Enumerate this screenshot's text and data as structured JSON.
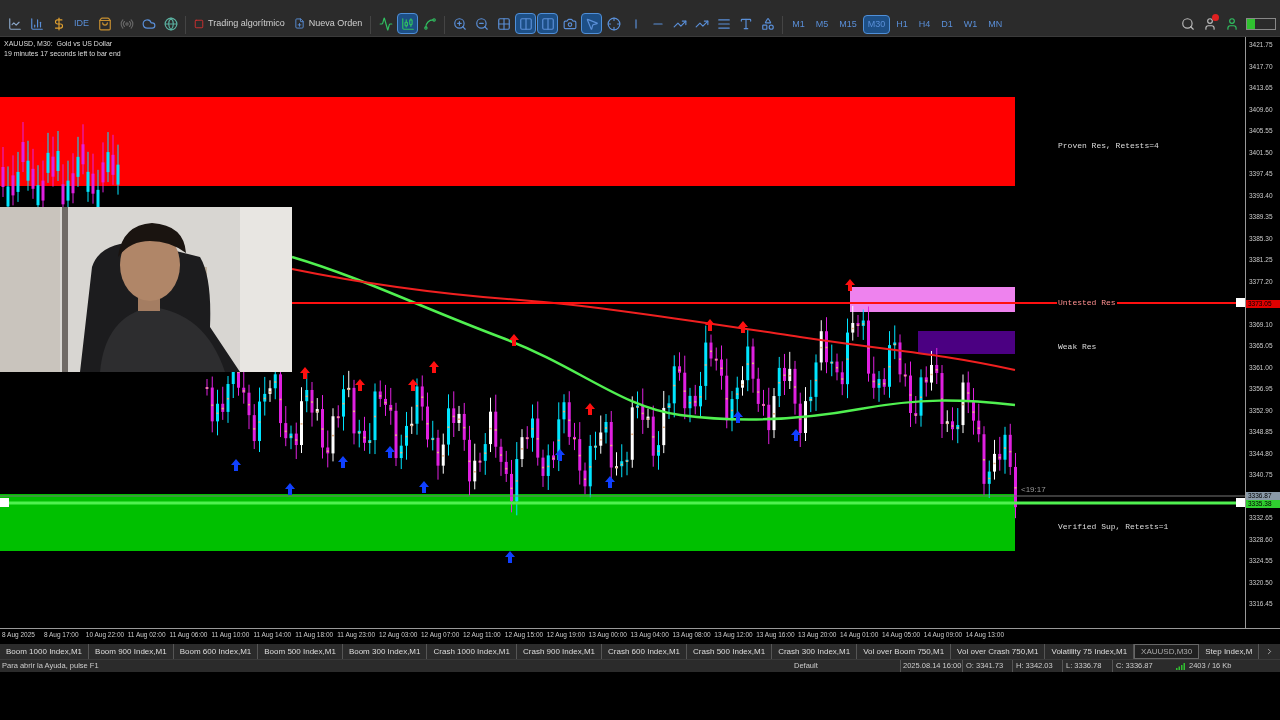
{
  "toolbar": {
    "ide_label": "IDE",
    "actions": [
      {
        "kind": "algo",
        "label": "Trading algorítmico"
      },
      {
        "kind": "order",
        "label": "Nueva Orden"
      }
    ],
    "timeframes": [
      {
        "label": "M1",
        "selected": false
      },
      {
        "label": "M5",
        "selected": false
      },
      {
        "label": "M15",
        "selected": false
      },
      {
        "label": "M30",
        "selected": true
      },
      {
        "label": "H1",
        "selected": false
      },
      {
        "label": "H4",
        "selected": false
      },
      {
        "label": "D1",
        "selected": false
      },
      {
        "label": "W1",
        "selected": false
      },
      {
        "label": "MN",
        "selected": false
      }
    ]
  },
  "chart": {
    "title": "XAUUSD, M30:  Gold vs US Dollar",
    "timer": "19 minutes 17 seconds left to bar end",
    "countdown": "<19:17",
    "zones": [
      {
        "kind": "proven",
        "label": "Proven Res, Retests=4",
        "color": "#ff0000"
      },
      {
        "kind": "untested",
        "label": "Untested Res",
        "color": "#ee82ee"
      },
      {
        "kind": "weak",
        "label": "Weak Res",
        "color": "#4b0082"
      },
      {
        "kind": "verified",
        "label": "Verified Sup, Retests=1",
        "color": "#00c000"
      }
    ],
    "price_ticks": [
      "3421.75",
      "3417.70",
      "3413.65",
      "3409.60",
      "3405.55",
      "3401.50",
      "3397.45",
      "3393.40",
      "3389.35",
      "3385.30",
      "3381.25",
      "3377.20",
      "3369.10",
      "3365.05",
      "3361.00",
      "3356.95",
      "3352.90",
      "3348.85",
      "3344.80",
      "3340.75",
      "3332.65",
      "3328.60",
      "3324.55",
      "3320.50",
      "3316.45"
    ],
    "price_tags": [
      {
        "label": "3373.05",
        "color": "#e00000"
      },
      {
        "label": "3336.87",
        "color": "#8a9aa8"
      },
      {
        "label": "3335.38",
        "color": "#30d030"
      }
    ],
    "time_ticks": [
      "8 Aug 2025",
      "8 Aug 17:00",
      "10 Aug 22:00",
      "11 Aug 02:00",
      "11 Aug 06:00",
      "11 Aug 10:00",
      "11 Aug 14:00",
      "11 Aug 18:00",
      "11 Aug 23:00",
      "12 Aug 03:00",
      "12 Aug 07:00",
      "12 Aug 11:00",
      "12 Aug 15:00",
      "12 Aug 19:00",
      "13 Aug 00:00",
      "13 Aug 04:00",
      "13 Aug 08:00",
      "13 Aug 12:00",
      "13 Aug 16:00",
      "13 Aug 20:00",
      "14 Aug 01:00",
      "14 Aug 05:00",
      "14 Aug 09:00",
      "14 Aug 13:00"
    ]
  },
  "tabs": [
    {
      "label": "Boom 1000 Index,M1",
      "selected": false
    },
    {
      "label": "Boom 900 Index,M1",
      "selected": false
    },
    {
      "label": "Boom 600 Index,M1",
      "selected": false
    },
    {
      "label": "Boom 500 Index,M1",
      "selected": false
    },
    {
      "label": "Boom 300 Index,M1",
      "selected": false
    },
    {
      "label": "Crash 1000 Index,M1",
      "selected": false
    },
    {
      "label": "Crash 900 Index,M1",
      "selected": false
    },
    {
      "label": "Crash 600 Index,M1",
      "selected": false
    },
    {
      "label": "Crash 500 Index,M1",
      "selected": false
    },
    {
      "label": "Crash 300 Index,M1",
      "selected": false
    },
    {
      "label": "Vol over Boom 750,M1",
      "selected": false
    },
    {
      "label": "Vol over Crash 750,M1",
      "selected": false
    },
    {
      "label": "Volatility 75 Index,M1",
      "selected": false
    },
    {
      "label": "XAUUSD,M30",
      "selected": true
    },
    {
      "label": "Step Index,M",
      "selected": false
    }
  ],
  "status_bar": {
    "help": "Para abrir la Ayuda, pulse F1",
    "profile": "Default",
    "datetime": "2025.08.14 16:00",
    "open": "O: 3341.73",
    "high": "H: 3342.03",
    "low": "L: 3336.78",
    "close": "C: 3336.87",
    "traffic": "2403 / 16 Kb"
  }
}
